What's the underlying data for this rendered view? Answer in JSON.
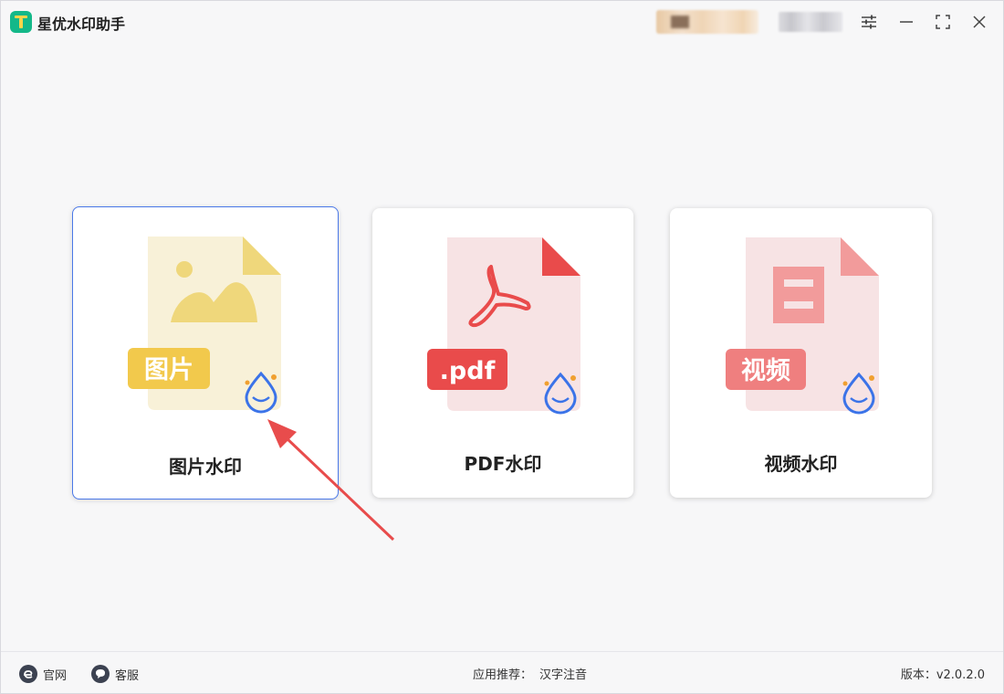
{
  "app": {
    "title": "星优水印助手"
  },
  "cards": [
    {
      "label": "图片水印",
      "badge": "图片",
      "selected": true
    },
    {
      "label": "PDF水印",
      "badge": ".pdf",
      "selected": false
    },
    {
      "label": "视频水印",
      "badge": "视频",
      "selected": false
    }
  ],
  "footer": {
    "website_label": "官网",
    "support_label": "客服",
    "recommend_label": "应用推荐：",
    "recommend_link": "汉字注音",
    "version_label": "版本：v2.0.2.0"
  },
  "colors": {
    "accent": "#4a78e8",
    "image_card": "#f2c94c",
    "pdf_card": "#e94b4b",
    "video_card": "#ef7f7f",
    "annotation_arrow": "#e84c4c"
  },
  "icons": {
    "app_logo": "brush-icon",
    "settings": "sliders-icon",
    "minimize": "minimize-icon",
    "maximize": "maximize-icon",
    "close": "close-icon",
    "website": "browser-e-icon",
    "support": "chat-bubble-icon",
    "watermark": "water-drop-icon"
  }
}
